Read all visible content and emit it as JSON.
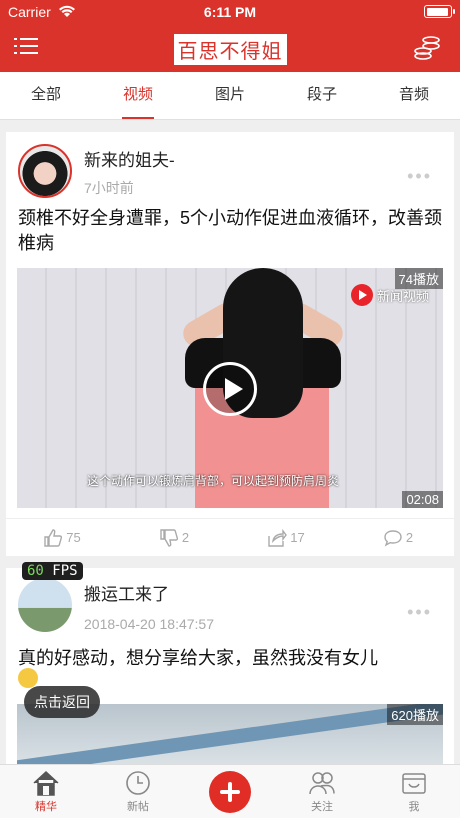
{
  "status_bar": {
    "carrier": "Carrier",
    "time": "6:11 PM"
  },
  "header": {
    "title": "百思不得姐",
    "accent_color": "#d9332b"
  },
  "tabs": [
    {
      "label": "全部",
      "active": false
    },
    {
      "label": "视频",
      "active": true
    },
    {
      "label": "图片",
      "active": false
    },
    {
      "label": "段子",
      "active": false
    },
    {
      "label": "音频",
      "active": false
    }
  ],
  "posts": [
    {
      "user": "新来的姐夫-",
      "time": "7小时前",
      "text": "颈椎不好全身遭罪，5个小动作促进血液循环，改善颈椎病",
      "video": {
        "play_count": "74播放",
        "duration": "02:08",
        "brand": "新闻视频",
        "subtitle": "这个动作可以锻炼肩背部，可以起到预防肩周炎"
      },
      "actions": {
        "likes": "75",
        "dislikes": "2",
        "shares": "17",
        "comments": "2"
      }
    },
    {
      "user": "搬运工来了",
      "time": "2018-04-20 18:47:57",
      "text": "真的好感动，想分享给大家，虽然我没有女儿",
      "video": {
        "play_count": "620播放"
      }
    }
  ],
  "overlay": {
    "fps_value": "60",
    "fps_unit": "FPS",
    "back_label": "点击返回"
  },
  "tabbar": [
    {
      "label": "精华",
      "icon": "house-icon",
      "active": true
    },
    {
      "label": "新帖",
      "icon": "clock-icon",
      "active": false
    },
    {
      "label": "",
      "icon": "plus-icon",
      "active": false
    },
    {
      "label": "关注",
      "icon": "people-icon",
      "active": false
    },
    {
      "label": "我",
      "icon": "inbox-icon",
      "active": false
    }
  ]
}
